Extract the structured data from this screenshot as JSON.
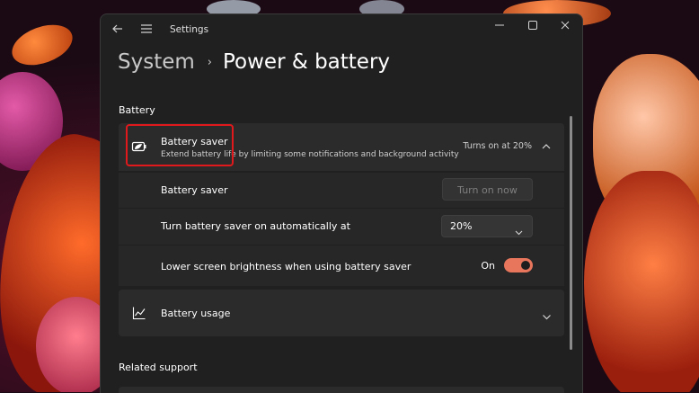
{
  "window": {
    "title": "Settings"
  },
  "breadcrumb": {
    "parent": "System",
    "separator": "›",
    "current": "Power & battery"
  },
  "sections": {
    "battery": "Battery",
    "related_support": "Related support"
  },
  "battery_saver": {
    "title": "Battery saver",
    "subtitle": "Extend battery life by limiting some notifications and background activity",
    "status": "Turns on at 20%",
    "icon": "battery-saver-icon",
    "expanded": true
  },
  "rows": {
    "saver_now": {
      "label": "Battery saver",
      "button": "Turn on now"
    },
    "auto": {
      "label": "Turn battery saver on automatically at",
      "value": "20%"
    },
    "brightness": {
      "label": "Lower screen brightness when using battery saver",
      "state": "On",
      "on": true
    }
  },
  "usage": {
    "label": "Battery usage",
    "icon": "chart-icon"
  },
  "colors": {
    "accent": "#e8765c",
    "highlight": "#e0191c",
    "window_bg": "#202020",
    "card_bg": "#2b2b2b"
  }
}
